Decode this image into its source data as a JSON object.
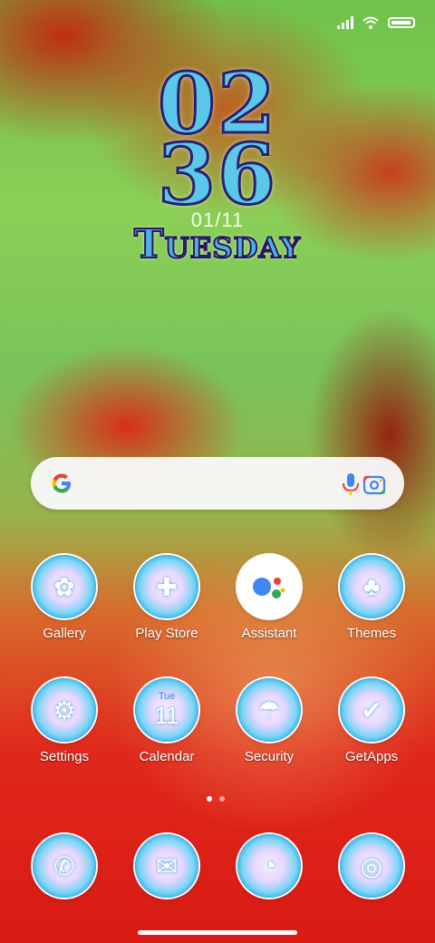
{
  "status": {
    "signal_icon": "signal-icon",
    "wifi_icon": "wifi-icon",
    "battery_icon": "battery-icon"
  },
  "clock": {
    "hours": "02",
    "minutes": "36",
    "date": "01/11",
    "day": "Tuesday"
  },
  "search": {
    "logo_icon": "google-logo-icon",
    "mic_icon": "mic-icon",
    "lens_icon": "lens-camera-icon"
  },
  "apps": [
    {
      "label": "Gallery",
      "icon": "gallery-icon"
    },
    {
      "label": "Play Store",
      "icon": "play-store-icon"
    },
    {
      "label": "Assistant",
      "icon": "assistant-icon"
    },
    {
      "label": "Themes",
      "icon": "themes-icon"
    },
    {
      "label": "Settings",
      "icon": "settings-icon"
    },
    {
      "label": "Calendar",
      "icon": "calendar-icon",
      "icon_text": "Tue",
      "icon_number": "11"
    },
    {
      "label": "Security",
      "icon": "security-icon"
    },
    {
      "label": "GetApps",
      "icon": "getapps-icon"
    }
  ],
  "dock": [
    {
      "icon": "phone-icon"
    },
    {
      "icon": "messages-icon"
    },
    {
      "icon": "browser-icon"
    },
    {
      "icon": "camera-icon"
    }
  ],
  "pager": {
    "pages": 2,
    "active": 1
  },
  "colors": {
    "accent_blue": "#5ac8e8",
    "text_outline": "#2a1f6e"
  }
}
